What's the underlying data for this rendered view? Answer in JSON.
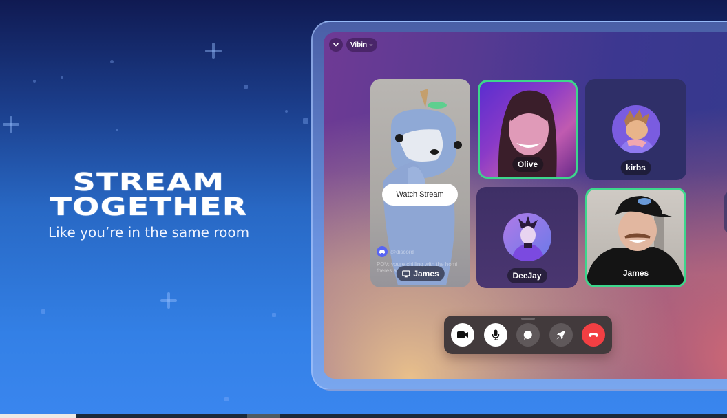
{
  "hero": {
    "title_line1": "STREAM",
    "title_line2": "TOGETHER",
    "subtitle": "Like you’re in the same room"
  },
  "call": {
    "collapse_icon": "chevron-down-icon",
    "channel_name": "Vibin",
    "channel_dropdown_icon": "chevron-down-icon",
    "stream_tile": {
      "button_label": "Watch Stream",
      "overlay_handle": "@discord",
      "overlay_caption_1": "POV: youre chilling with the homi",
      "overlay_caption_2": "theres a",
      "streamer_name": "James",
      "streamer_icon": "screen-share-icon"
    },
    "participants": [
      {
        "name": "Olive",
        "type": "video",
        "speaking": true
      },
      {
        "name": "kirbs",
        "type": "avatar",
        "speaking": false
      },
      {
        "name": "DeeJay",
        "type": "avatar",
        "speaking": false
      },
      {
        "name": "James",
        "type": "video",
        "speaking": true
      }
    ],
    "controls": [
      {
        "name": "camera",
        "icon": "video-camera-icon",
        "active": true
      },
      {
        "name": "microphone",
        "icon": "microphone-icon",
        "active": true
      },
      {
        "name": "chat",
        "icon": "chat-bubble-icon",
        "active": false
      },
      {
        "name": "activities",
        "icon": "rocket-icon",
        "active": false
      },
      {
        "name": "disconnect",
        "icon": "hang-up-icon",
        "active": false
      }
    ]
  },
  "colors": {
    "speaking_ring": "#3dd68c",
    "disconnect": "#f23f43",
    "control_bar": "#423a3c"
  }
}
